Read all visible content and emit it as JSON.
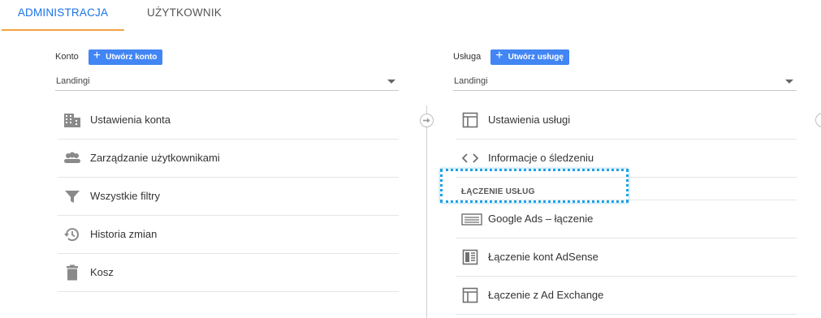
{
  "tabs": {
    "admin": "ADMINISTRACJA",
    "user": "UŻYTKOWNIK"
  },
  "account": {
    "label": "Konto",
    "create_button": "Utwórz konto",
    "selected": "Landingi",
    "items": [
      {
        "label": "Ustawienia konta",
        "icon": "building-icon"
      },
      {
        "label": "Zarządzanie użytkownikami",
        "icon": "people-icon"
      },
      {
        "label": "Wszystkie filtry",
        "icon": "filter-icon"
      },
      {
        "label": "Historia zmian",
        "icon": "history-icon"
      },
      {
        "label": "Kosz",
        "icon": "trash-icon"
      }
    ]
  },
  "property": {
    "label": "Usługa",
    "create_button": "Utwórz usługę",
    "selected": "Landingi",
    "items": [
      {
        "label": "Ustawienia usługi",
        "icon": "layout-icon"
      },
      {
        "label": "Informacje o śledzeniu",
        "icon": "code-icon"
      }
    ],
    "links_section": "ŁĄCZENIE USŁUG",
    "links": [
      {
        "label": "Google Ads – łączenie",
        "icon": "ads-icon"
      },
      {
        "label": "Łączenie kont AdSense",
        "icon": "adsense-icon"
      },
      {
        "label": "Łączenie z Ad Exchange",
        "icon": "layout-icon"
      }
    ]
  },
  "colors": {
    "accent_blue": "#4285f4",
    "tab_active": "#1a73e8",
    "tab_underline": "#f4a340",
    "highlight": "#1da1e8"
  }
}
